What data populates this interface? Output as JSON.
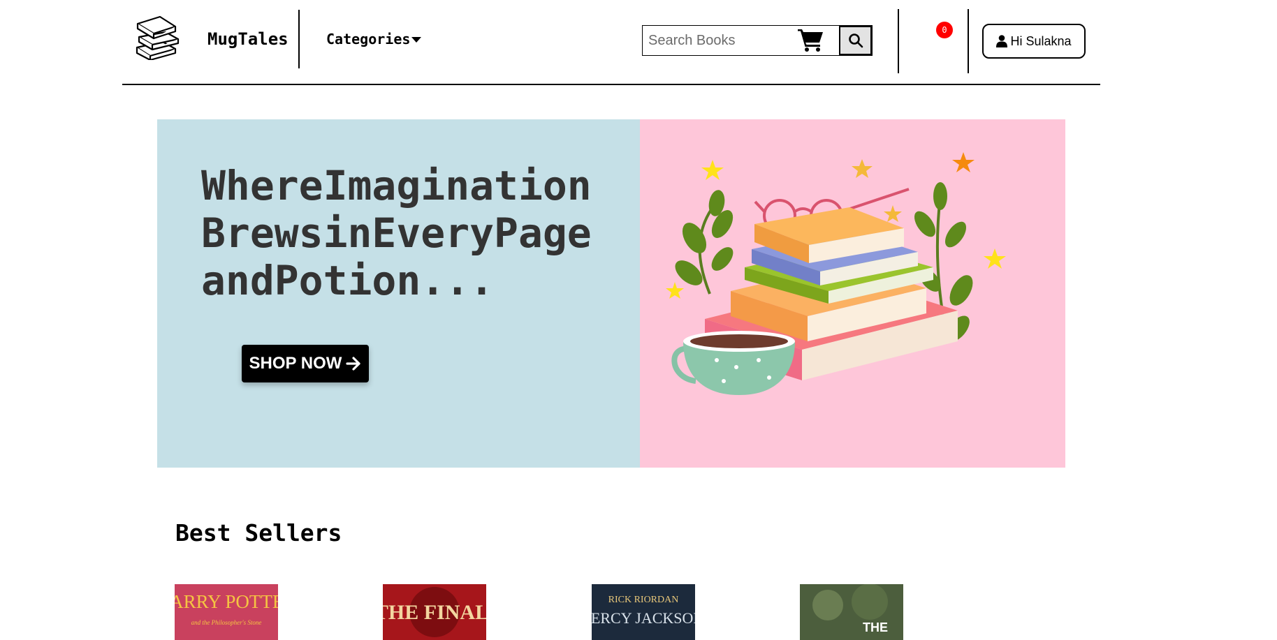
{
  "header": {
    "brand": "MugTales",
    "categories_label": "Categories",
    "search_placeholder": "Search Books",
    "cart_count": "0",
    "user_label": "Hi Sulakna"
  },
  "hero": {
    "title_lines": [
      "WhereImagination",
      "BrewsinEveryPage",
      "andPotion..."
    ],
    "cta_label": "SHOP NOW"
  },
  "best_sellers": {
    "title": "Best Sellers",
    "books": [
      {
        "cover_title": "HARRY POTTER",
        "cover_subtitle": "and the Philosopher's Stone",
        "color": "#c9415e"
      },
      {
        "cover_title": "THE FINAL",
        "color": "#a6161b"
      },
      {
        "cover_author": "RICK RIORDAN",
        "cover_title": "PERCY JACKSON",
        "color": "#1c2a3c"
      },
      {
        "cover_title": "THE",
        "color": "#3d4f33"
      }
    ]
  },
  "colors": {
    "hero_left_bg": "#c5e0e7",
    "hero_right_bg": "#fec6d9",
    "badge": "#ff0000",
    "text_dark": "#333333"
  },
  "icons": [
    "books-logo-icon",
    "caret-down-icon",
    "search-icon",
    "cart-icon",
    "user-icon",
    "arrow-right-icon"
  ]
}
